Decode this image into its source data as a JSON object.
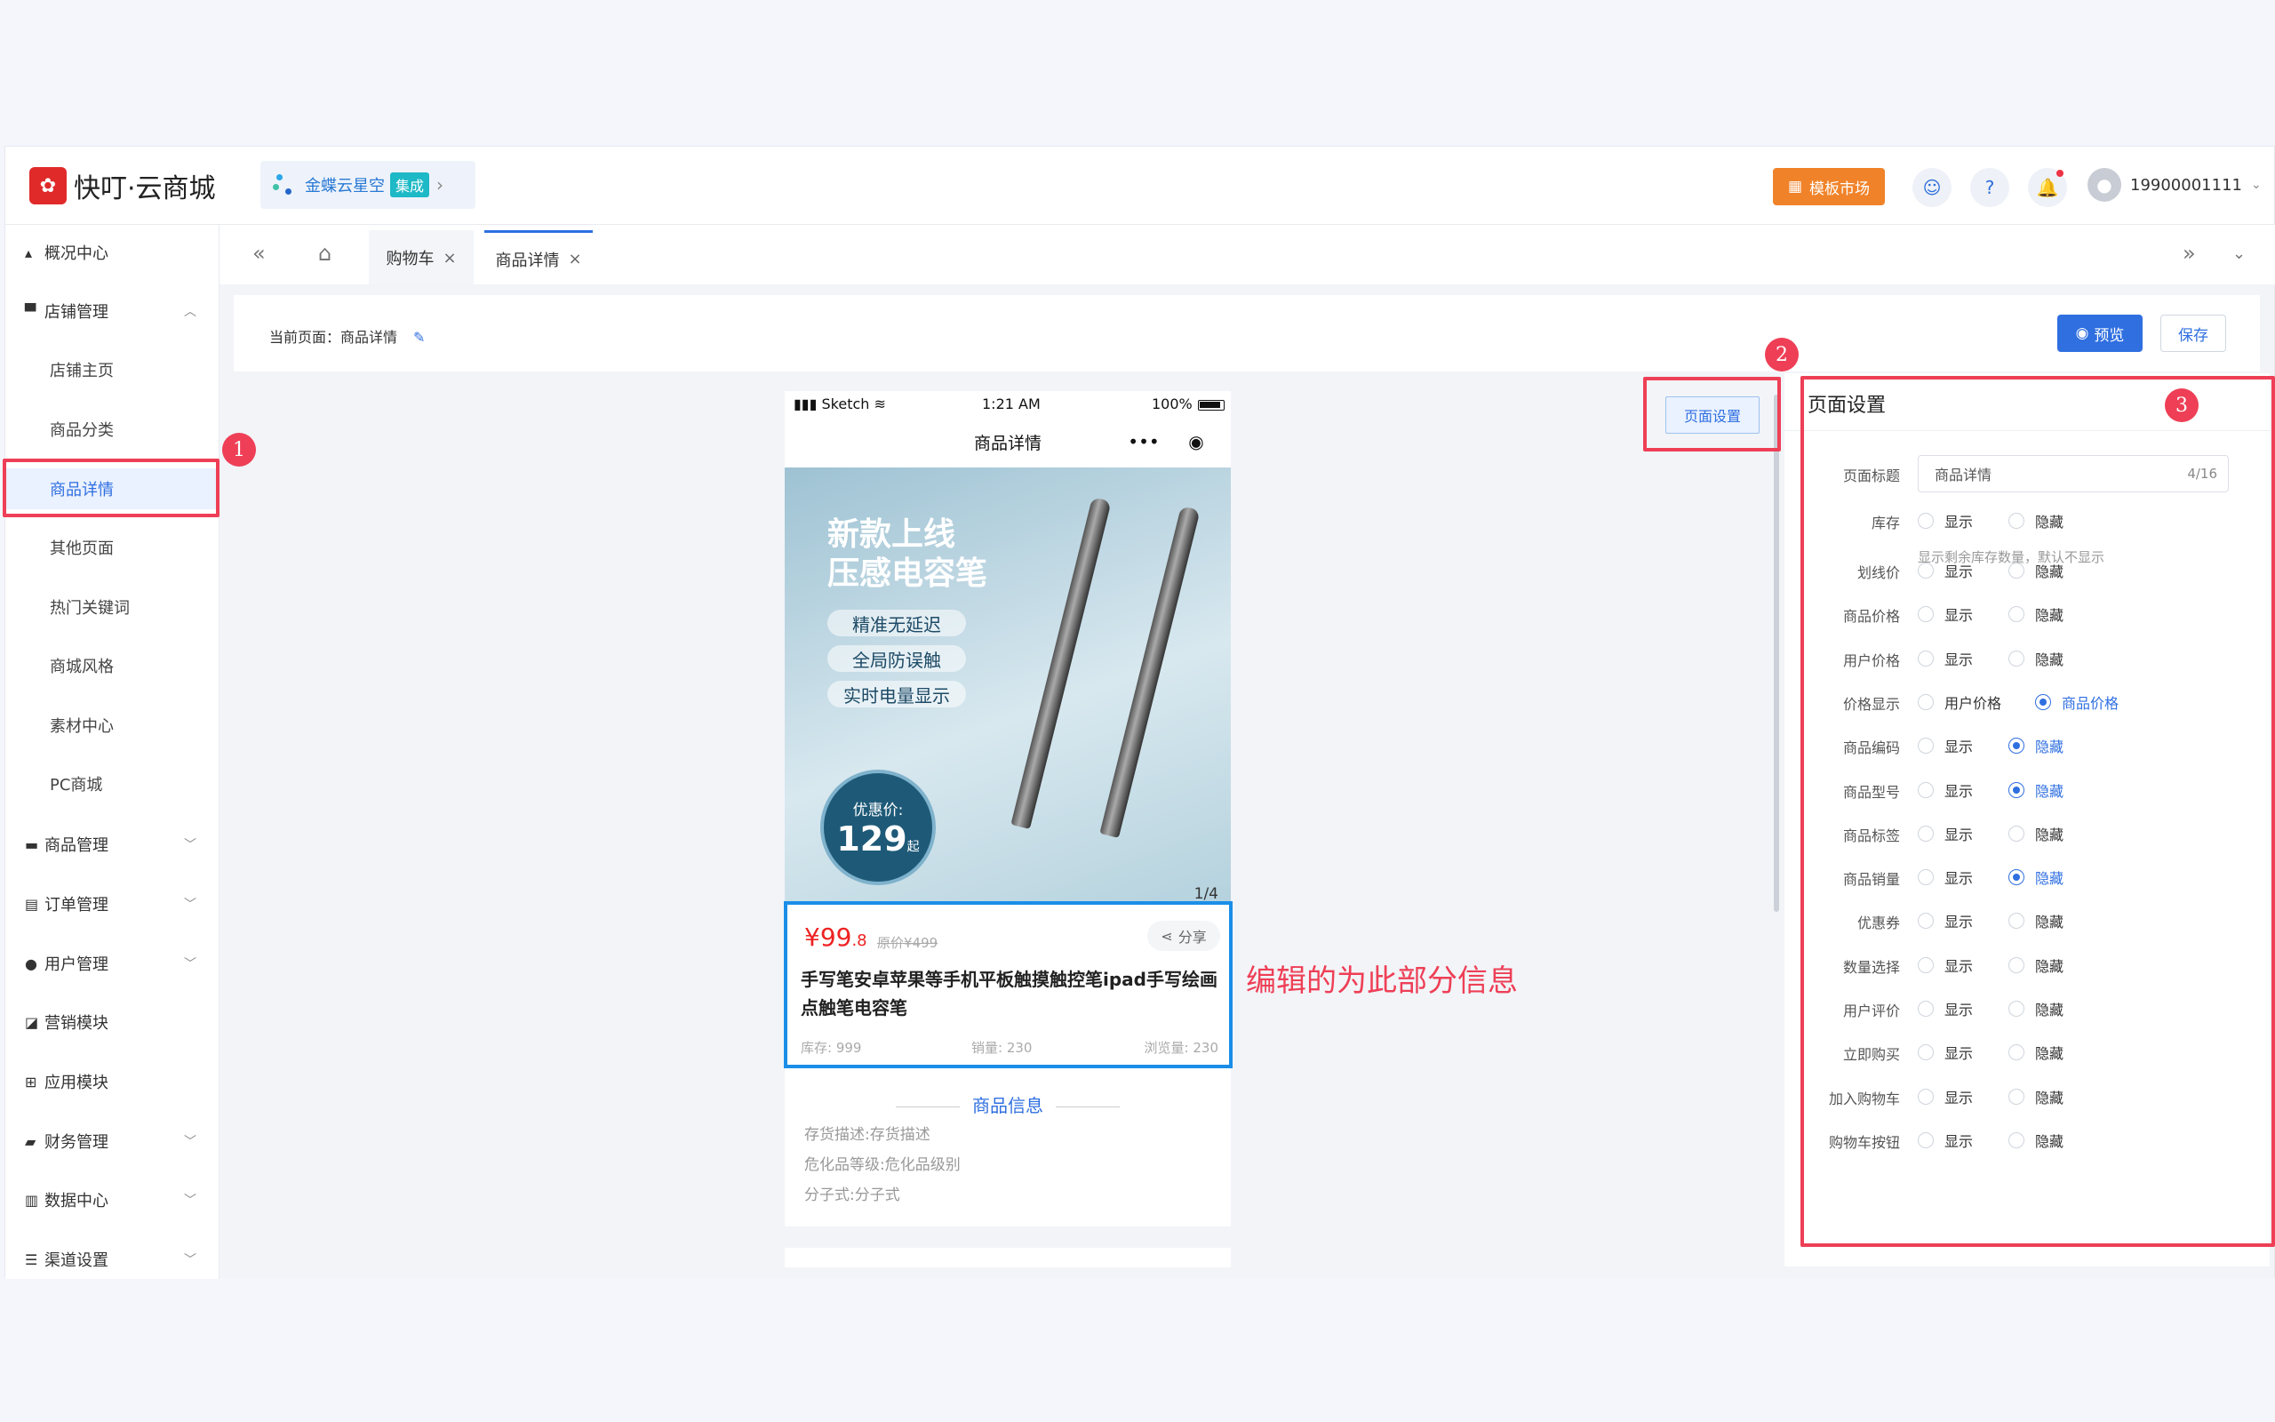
{
  "header": {
    "brand": "快叮·云商城",
    "integration_name": "金蝶云星空",
    "integration_badge": "集成",
    "template_market": "模板市场",
    "user_phone": "19900001111"
  },
  "sidebar": {
    "items": [
      {
        "label": "概况中心",
        "icon": "shop-icon"
      },
      {
        "label": "店铺管理",
        "icon": "store-icon"
      },
      {
        "label": "店铺主页"
      },
      {
        "label": "商品分类"
      },
      {
        "label": "商品详情"
      },
      {
        "label": "其他页面"
      },
      {
        "label": "热门关键词"
      },
      {
        "label": "商城风格"
      },
      {
        "label": "素材中心"
      },
      {
        "label": "PC商城"
      },
      {
        "label": "商品管理",
        "icon": "briefcase-icon"
      },
      {
        "label": "订单管理",
        "icon": "clipboard-icon"
      },
      {
        "label": "用户管理",
        "icon": "user-icon"
      },
      {
        "label": "营销模块",
        "icon": "chart-icon"
      },
      {
        "label": "应用模块",
        "icon": "grid-icon"
      },
      {
        "label": "财务管理",
        "icon": "wallet-icon"
      },
      {
        "label": "数据中心",
        "icon": "bar-chart-icon"
      },
      {
        "label": "渠道设置",
        "icon": "list-icon"
      }
    ]
  },
  "tabs": [
    {
      "label": "购物车"
    },
    {
      "label": "商品详情"
    }
  ],
  "toolbar": {
    "current_page": "当前页面：商品详情",
    "preview": "预览",
    "save": "保存"
  },
  "phone": {
    "carrier": "Sketch",
    "time": "1:21 AM",
    "battery": "100%",
    "nav_title": "商品详情",
    "banner_line1": "新款上线",
    "banner_line2": "压感电容笔",
    "pill1": "精准无延迟",
    "pill2": "全局防误触",
    "pill3": "实时电量显示",
    "promo_label": "优惠价:",
    "promo_value": "129",
    "promo_suffix": "起",
    "pager": "1/4",
    "price": "¥99",
    "price_dec": ".8",
    "orig_price": "原价¥499",
    "share": "分享",
    "title": "手写笔安卓苹果等手机平板触摸触控笔ipad手写绘画点触笔电容笔",
    "stock": "库存: 999",
    "sales": "销量: 230",
    "views": "浏览量: 230",
    "info_heading": "商品信息",
    "info_lines": [
      "存货描述:存货描述",
      "危化品等级:危化品级别",
      "分子式:分子式"
    ]
  },
  "annotation": "编辑的为此部分信息",
  "badges": [
    "1",
    "2",
    "3"
  ],
  "page_settings_button": "页面设置",
  "panel": {
    "title": "页面设置",
    "title_label": "页面标题",
    "title_value": "商品详情",
    "title_count": "4/16",
    "stock_hint": "显示剩余库存数量，默认不显示",
    "show": "显示",
    "hide": "隐藏",
    "rows": [
      {
        "label": "库存",
        "selected": "none"
      },
      {
        "label": "划线价",
        "selected": "none"
      },
      {
        "label": "商品价格",
        "selected": "none"
      },
      {
        "label": "用户价格",
        "selected": "none"
      },
      {
        "label": "价格显示",
        "opt1": "用户价格",
        "opt2": "商品价格",
        "selected": "opt2"
      },
      {
        "label": "商品编码",
        "selected": "hide"
      },
      {
        "label": "商品型号",
        "selected": "hide"
      },
      {
        "label": "商品标签",
        "selected": "none"
      },
      {
        "label": "商品销量",
        "selected": "hide"
      },
      {
        "label": "优惠券",
        "selected": "none"
      },
      {
        "label": "数量选择",
        "selected": "none"
      },
      {
        "label": "用户评价",
        "selected": "none"
      },
      {
        "label": "立即购买",
        "selected": "none"
      },
      {
        "label": "加入购物车",
        "selected": "none"
      },
      {
        "label": "购物车按钮",
        "selected": "none"
      }
    ]
  },
  "colors": {
    "accent": "#2f6fe0",
    "highlight_red": "#ee3f56",
    "highlight_blue": "#1a8ee8",
    "price_red": "#e22222"
  }
}
